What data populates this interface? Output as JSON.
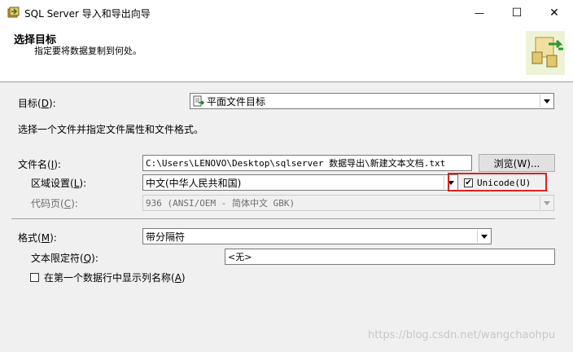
{
  "window": {
    "title": "SQL Server 导入和导出向导",
    "minimize_glyph": "—",
    "maximize_glyph": "☐",
    "close_glyph": "✕"
  },
  "header": {
    "title": "选择目标",
    "subtitle": "指定要将数据复制到何处。"
  },
  "destination": {
    "label": "目标",
    "accel": "D",
    "value": "平面文件目标",
    "icon": "flat-file-icon"
  },
  "instruction": "选择一个文件并指定文件属性和文件格式。",
  "file": {
    "label": "文件名",
    "accel": "I",
    "value": "C:\\Users\\LENOVO\\Desktop\\sqlserver 数据导出\\新建文本文档.txt",
    "browse_label": "浏览(W)..."
  },
  "locale": {
    "label": "区域设置",
    "accel": "L",
    "value": "中文(中华人民共和国)"
  },
  "unicode": {
    "label": "Unicode(U)",
    "checked": true
  },
  "codepage": {
    "label": "代码页",
    "accel": "C",
    "value": "936   (ANSI/OEM - 简体中文 GBK)"
  },
  "format": {
    "label": "格式",
    "accel": "M",
    "value": "带分隔符"
  },
  "text_qualifier": {
    "label": "文本限定符",
    "accel": "Q",
    "value": "<无>"
  },
  "header_row": {
    "label": "在第一个数据行中显示列名称",
    "accel": "A",
    "checked": false
  },
  "watermark": "https://blog.csdn.net/wangchaohpu",
  "colors": {
    "highlight_box": "#e02020",
    "panel_bg": "#f0f0f0"
  }
}
